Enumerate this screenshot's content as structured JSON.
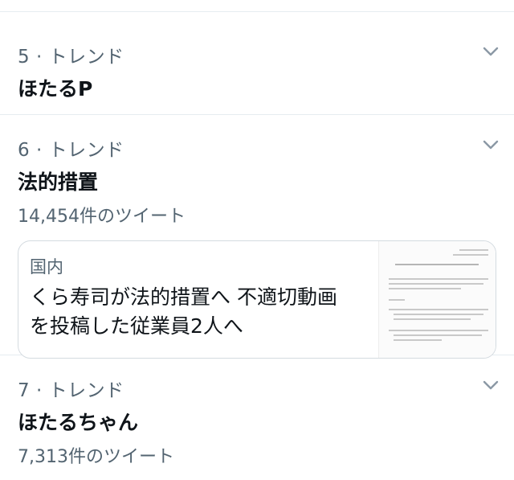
{
  "trends": [
    {
      "meta": "5 · トレンド",
      "title": "ほたるP",
      "count": ""
    },
    {
      "meta": "6 · トレンド",
      "title": "法的措置",
      "count": "14,454件のツイート",
      "news": {
        "category": "国内",
        "headline_line1": "くら寿司が法的措置へ 不適切動画",
        "headline_line2": "を投稿した従業員2人へ",
        "thumbnail": "document-image"
      }
    },
    {
      "meta": "7 · トレンド",
      "title": "ほたるちゃん",
      "count": "7,313件のツイート"
    }
  ],
  "icons": {
    "more": "chevron-down-icon"
  },
  "colors": {
    "text": "#0f1419",
    "secondary": "#536471",
    "divider": "#e6ecf0",
    "chevron": "#8b98a5"
  }
}
